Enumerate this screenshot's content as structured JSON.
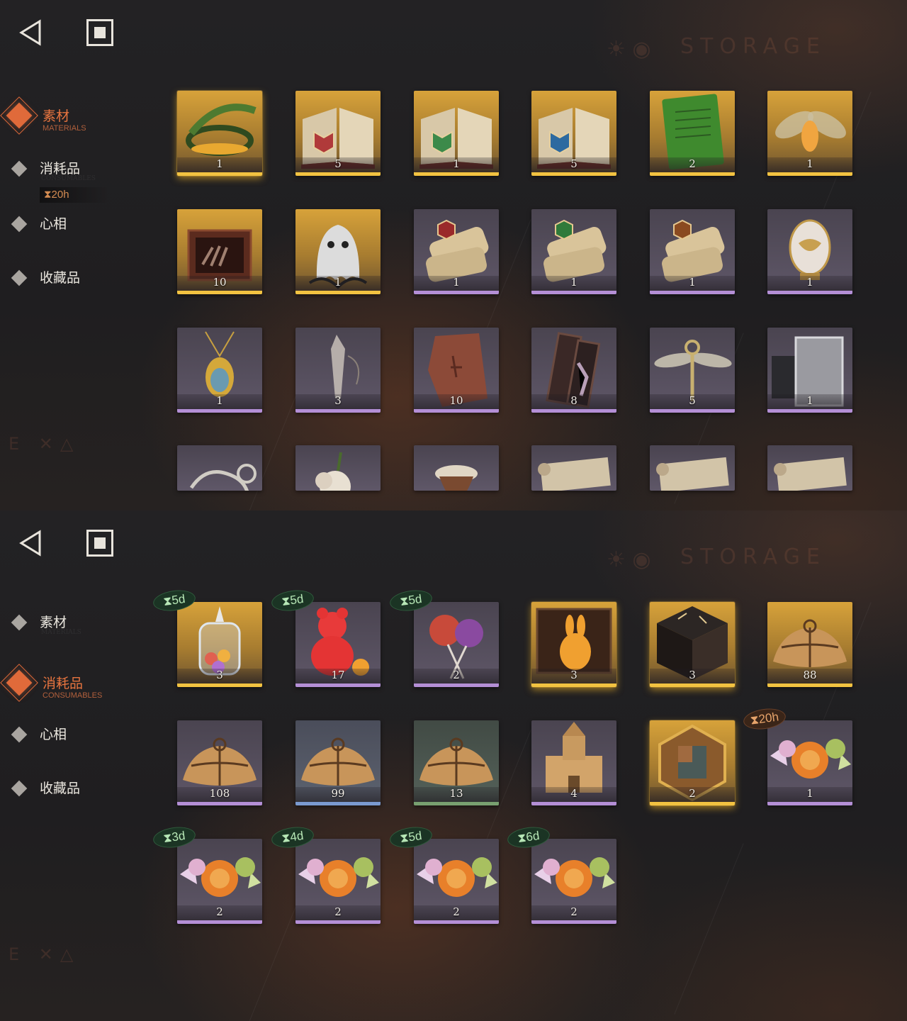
{
  "nav": {
    "back_icon": "back-triangle-icon",
    "home_icon": "home-square-icon"
  },
  "watermark": {
    "title": "STORAGE",
    "corner": "E ✕△"
  },
  "screens": [
    {
      "sidebar": [
        {
          "label": "素材",
          "sub": "MATERIALS",
          "active": true
        },
        {
          "label": "消耗品",
          "sub": "CONSUMABLES",
          "active": false,
          "timer": "⧗20h"
        },
        {
          "label": "心相",
          "sub": "",
          "active": false
        },
        {
          "label": "收藏品",
          "sub": "",
          "active": false
        }
      ],
      "rows": [
        [
          {
            "name": "laurel-wreath",
            "count": "1",
            "rarity": "gold"
          },
          {
            "name": "red-tome",
            "count": "5",
            "rarity": "gold"
          },
          {
            "name": "green-tome",
            "count": "1",
            "rarity": "gold"
          },
          {
            "name": "blue-tome",
            "count": "5",
            "rarity": "gold"
          },
          {
            "name": "green-book",
            "count": "2",
            "rarity": "gold"
          },
          {
            "name": "glowing-moth",
            "count": "1",
            "rarity": "gold"
          }
        ],
        [
          {
            "name": "claw-box",
            "count": "10",
            "rarity": "gold"
          },
          {
            "name": "ghost-figure",
            "count": "1",
            "rarity": "gold"
          },
          {
            "name": "red-scroll",
            "count": "1",
            "rarity": "purple"
          },
          {
            "name": "green-scroll",
            "count": "1",
            "rarity": "purple"
          },
          {
            "name": "house-scroll",
            "count": "1",
            "rarity": "purple"
          },
          {
            "name": "jeweled-egg",
            "count": "1",
            "rarity": "purple"
          }
        ],
        [
          {
            "name": "amulet-necklace",
            "count": "1",
            "rarity": "purple"
          },
          {
            "name": "crystal-pendulum",
            "count": "3",
            "rarity": "purple"
          },
          {
            "name": "stone-tablet",
            "count": "10",
            "rarity": "purple"
          },
          {
            "name": "crystal-case",
            "count": "8",
            "rarity": "purple"
          },
          {
            "name": "winged-key",
            "count": "5",
            "rarity": "purple"
          },
          {
            "name": "silver-ingot",
            "count": "1",
            "rarity": "purple"
          }
        ],
        [
          {
            "name": "bone-skeleton",
            "count": "",
            "rarity": "purple"
          },
          {
            "name": "flower-bloom",
            "count": "",
            "rarity": "purple"
          },
          {
            "name": "masked-figure",
            "count": "",
            "rarity": "purple"
          },
          {
            "name": "scroll-letter",
            "count": "",
            "rarity": "purple"
          },
          {
            "name": "scroll-letter",
            "count": "",
            "rarity": "purple"
          },
          {
            "name": "scroll-letter",
            "count": "",
            "rarity": "purple"
          }
        ]
      ]
    },
    {
      "sidebar": [
        {
          "label": "素材",
          "sub": "MATERIALS",
          "active": false
        },
        {
          "label": "消耗品",
          "sub": "CONSUMABLES",
          "active": true
        },
        {
          "label": "心相",
          "sub": "",
          "active": false
        },
        {
          "label": "收藏品",
          "sub": "",
          "active": false
        }
      ],
      "rows": [
        [
          {
            "name": "candy-jar",
            "count": "3",
            "rarity": "gold",
            "badge": "⧗5d"
          },
          {
            "name": "gummy-bear",
            "count": "17",
            "rarity": "purple",
            "badge": "⧗5d"
          },
          {
            "name": "lollipops",
            "count": "2",
            "rarity": "purple",
            "badge": "⧗5d"
          },
          {
            "name": "golden-rabbit-box",
            "count": "3",
            "rarity": "gold"
          },
          {
            "name": "rune-cube",
            "count": "3",
            "rarity": "gold"
          },
          {
            "name": "parcel",
            "count": "88",
            "rarity": "gold"
          }
        ],
        [
          {
            "name": "parcel",
            "count": "108",
            "rarity": "purple"
          },
          {
            "name": "parcel",
            "count": "99",
            "rarity": "blue"
          },
          {
            "name": "parcel",
            "count": "13",
            "rarity": "green"
          },
          {
            "name": "block-castle",
            "count": "4",
            "rarity": "purple"
          },
          {
            "name": "puzzle-hexagon",
            "count": "2",
            "rarity": "gold"
          },
          {
            "name": "wrapped-candies",
            "count": "1",
            "rarity": "purple",
            "badge": "⧗20h",
            "warn": true
          }
        ],
        [
          {
            "name": "wrapped-candies",
            "count": "2",
            "rarity": "purple",
            "badge": "⧗3d"
          },
          {
            "name": "wrapped-candies",
            "count": "2",
            "rarity": "purple",
            "badge": "⧗4d"
          },
          {
            "name": "wrapped-candies",
            "count": "2",
            "rarity": "purple",
            "badge": "⧗5d"
          },
          {
            "name": "wrapped-candies",
            "count": "2",
            "rarity": "purple",
            "badge": "⧗6d"
          }
        ]
      ]
    }
  ]
}
